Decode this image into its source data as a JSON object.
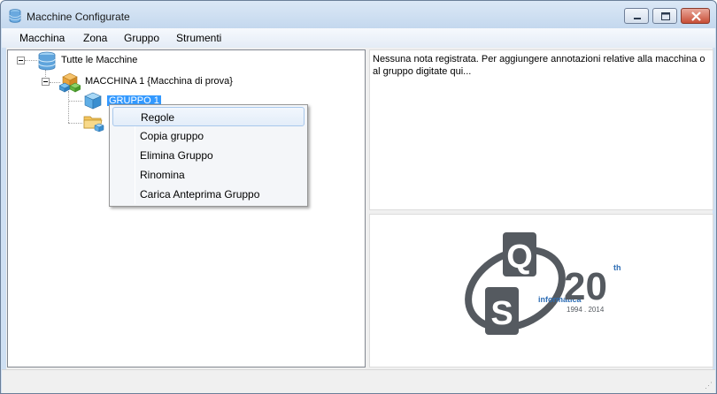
{
  "window": {
    "title": "Macchine Configurate"
  },
  "menu": {
    "items": [
      "Macchina",
      "Zona",
      "Gruppo",
      "Strumenti"
    ]
  },
  "tree": {
    "root_label": "Tutte le Macchine",
    "machine_label": "MACCHINA 1 {Macchina di prova}",
    "group_label": "GRUPPO 1"
  },
  "context_menu": {
    "items": [
      "Regole",
      "Copia gruppo",
      "Elimina Gruppo",
      "Rinomina",
      "Carica Anteprima Gruppo"
    ],
    "highlighted": "Regole"
  },
  "notes": {
    "text": "Nessuna nota registrata. Per aggiungere annotazioni relative alla macchina o al gruppo digitate qui..."
  },
  "logo": {
    "letter_q": "Q",
    "letter_s": "S",
    "company": "informatica",
    "anniversary": "20",
    "suffix": "th",
    "years": "1994 . 2014"
  },
  "colors": {
    "selection": "#3399ff",
    "logo_gray": "#555a60",
    "logo_blue": "#2f6eb5"
  }
}
